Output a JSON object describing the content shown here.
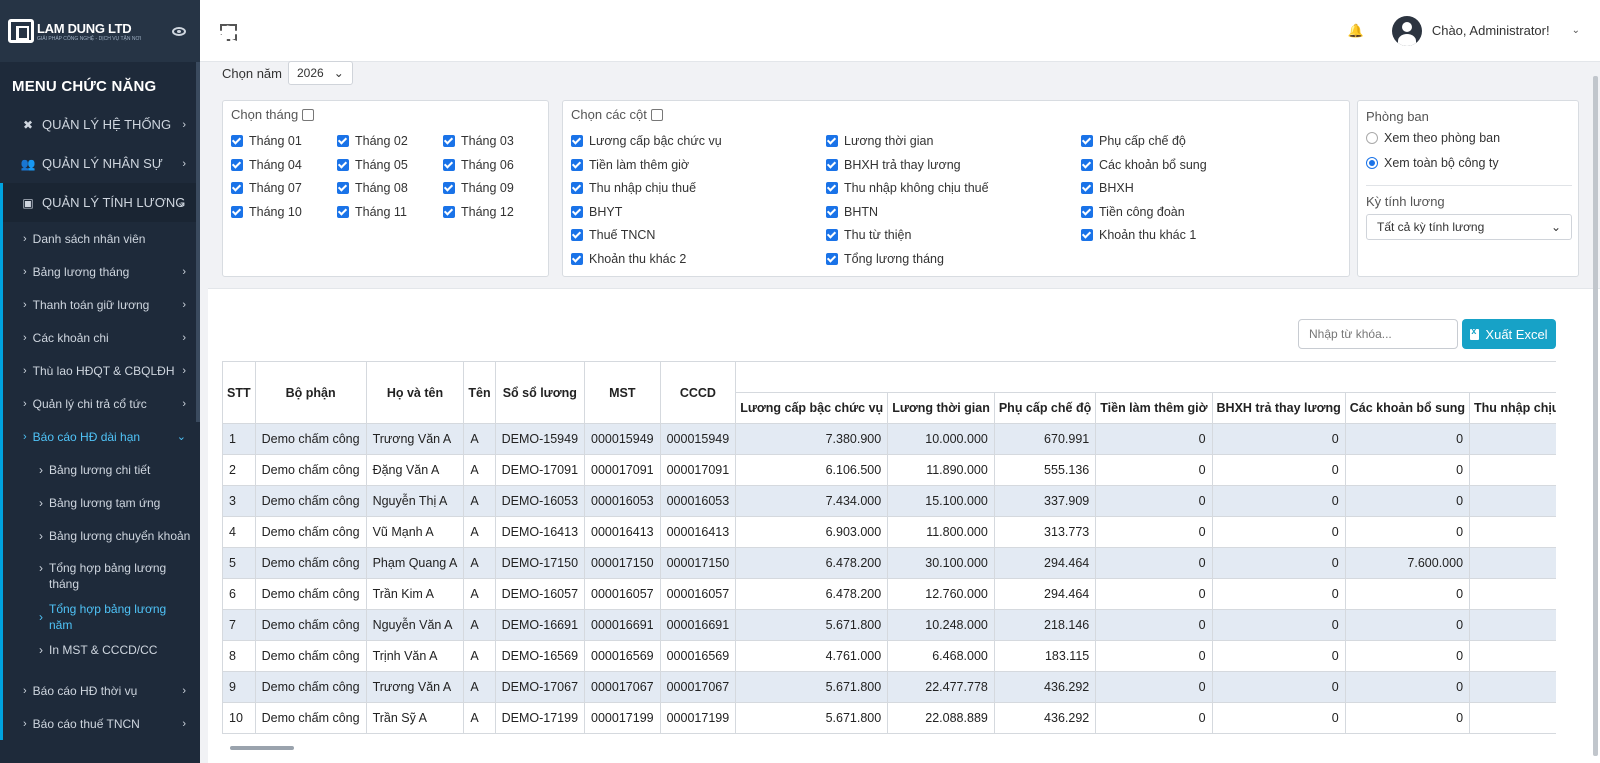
{
  "brand": {
    "name": "LAM DUNG LTD",
    "tagline": "GIẢI PHÁP CÔNG NGHỆ - DỊCH VỤ TẬN NƠI"
  },
  "sidebar": {
    "menu_title": "MENU CHỨC NĂNG",
    "items": [
      {
        "label": "QUẢN LÝ HỆ THỐNG",
        "icon": "tools-icon"
      },
      {
        "label": "QUẢN LÝ NHÂN SỰ",
        "icon": "users-icon"
      },
      {
        "label": "QUẢN LÝ TÍNH LƯƠNG",
        "icon": "money-icon"
      }
    ],
    "sub_items": [
      "Danh sách nhân viên",
      "Bảng lương tháng",
      "Thanh toán giữ lương",
      "Các khoản chi",
      "Thù lao HĐQT & CBQLĐH",
      "Quản lý chi trả cổ tức",
      "Báo cáo HĐ dài hạn"
    ],
    "subsub_items": [
      "Bảng lương chi tiết",
      "Bảng lương tạm ứng",
      "Bảng lương chuyển khoản",
      "Tổng hợp bảng lương tháng",
      "Tổng hợp bảng lương năm",
      "In MST & CCCD/CC"
    ],
    "after_items": [
      "Báo cáo HĐ thời vụ",
      "Báo cáo thuế TNCN"
    ]
  },
  "header": {
    "greeting": "Chào, Administrator!"
  },
  "filters": {
    "year_label": "Chọn năm",
    "year_value": "2026",
    "month_title": "Chọn tháng",
    "months": [
      "Tháng 01",
      "Tháng 02",
      "Tháng 03",
      "Tháng 04",
      "Tháng 05",
      "Tháng 06",
      "Tháng 07",
      "Tháng 08",
      "Tháng 09",
      "Tháng 10",
      "Tháng 11",
      "Tháng 12"
    ],
    "column_title": "Chọn các cột",
    "columns": [
      "Lương cấp bậc chức vụ",
      "Lương thời gian",
      "Phụ cấp chế độ",
      "Tiền làm thêm giờ",
      "BHXH trả thay lương",
      "Các khoản bổ sung",
      "Thu nhập chịu thuế",
      "Thu nhập không chịu thuế",
      "BHXH",
      "BHYT",
      "BHTN",
      "Tiền công đoàn",
      "Thuế TNCN",
      "Thu từ thiện",
      "Khoản thu khác 1",
      "Khoản thu khác 2",
      "Tổng lương tháng"
    ],
    "dept_title": "Phòng ban",
    "dept_options": [
      "Xem theo phòng ban",
      "Xem toàn bộ công ty"
    ],
    "period_title": "Kỳ tính lương",
    "period_value": "Tất cả kỳ tính lương"
  },
  "toolbar": {
    "search_placeholder": "Nhập từ khóa...",
    "excel_label": "Xuất Excel"
  },
  "table": {
    "fixed_headers": [
      "STT",
      "Bộ phận",
      "Họ và tên",
      "Tên",
      "Sổ sổ lương",
      "MST",
      "CCCD"
    ],
    "value_headers": [
      "Lương cấp bậc chức vụ",
      "Lương thời gian",
      "Phụ cấp chế độ",
      "Tiền làm thêm giờ",
      "BHXH trả thay lương",
      "Các khoản bổ sung",
      "Thu nhập chịu thuế"
    ],
    "rows": [
      [
        "1",
        "Demo chấm công",
        "Trương Văn A",
        "A",
        "DEMO-15949",
        "000015949",
        "000015949",
        "7.380.900",
        "10.000.000",
        "670.991",
        "0",
        "0",
        "0",
        ""
      ],
      [
        "2",
        "Demo chấm công",
        "Đặng Văn A",
        "A",
        "DEMO-17091",
        "000017091",
        "000017091",
        "6.106.500",
        "11.890.000",
        "555.136",
        "0",
        "0",
        "0",
        ""
      ],
      [
        "3",
        "Demo chấm công",
        "Nguyễn Thị A",
        "A",
        "DEMO-16053",
        "000016053",
        "000016053",
        "7.434.000",
        "15.100.000",
        "337.909",
        "0",
        "0",
        "0",
        ""
      ],
      [
        "4",
        "Demo chấm công",
        "Vũ Mạnh A",
        "A",
        "DEMO-16413",
        "000016413",
        "000016413",
        "6.903.000",
        "11.800.000",
        "313.773",
        "0",
        "0",
        "0",
        ""
      ],
      [
        "5",
        "Demo chấm công",
        "Phạm Quang A",
        "A",
        "DEMO-17150",
        "000017150",
        "000017150",
        "6.478.200",
        "30.100.000",
        "294.464",
        "0",
        "0",
        "7.600.000",
        ""
      ],
      [
        "6",
        "Demo chấm công",
        "Trần Kim A",
        "A",
        "DEMO-16057",
        "000016057",
        "000016057",
        "6.478.200",
        "12.760.000",
        "294.464",
        "0",
        "0",
        "0",
        ""
      ],
      [
        "7",
        "Demo chấm công",
        "Nguyễn Văn A",
        "A",
        "DEMO-16691",
        "000016691",
        "000016691",
        "5.671.800",
        "10.248.000",
        "218.146",
        "0",
        "0",
        "0",
        ""
      ],
      [
        "8",
        "Demo chấm công",
        "Trịnh Văn A",
        "A",
        "DEMO-16569",
        "000016569",
        "000016569",
        "4.761.000",
        "6.468.000",
        "183.115",
        "0",
        "0",
        "0",
        ""
      ],
      [
        "9",
        "Demo chấm công",
        "Trương Văn A",
        "A",
        "DEMO-17067",
        "000017067",
        "000017067",
        "5.671.800",
        "22.477.778",
        "436.292",
        "0",
        "0",
        "0",
        ""
      ],
      [
        "10",
        "Demo chấm công",
        "Trần Sỹ A",
        "A",
        "DEMO-17199",
        "000017199",
        "000017199",
        "5.671.800",
        "22.088.889",
        "436.292",
        "0",
        "0",
        "0",
        ""
      ]
    ]
  }
}
